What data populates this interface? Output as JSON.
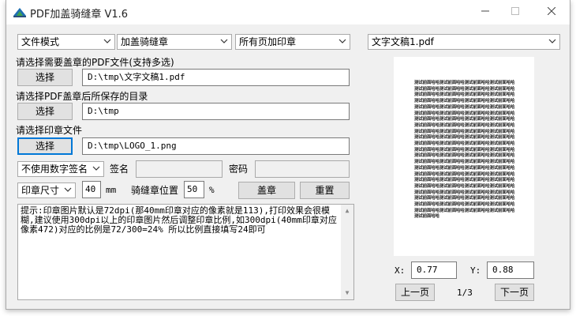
{
  "window": {
    "title": "PDF加盖骑缝章 V1.6",
    "icon": "pdf-stamp-app-icon"
  },
  "top": {
    "mode_select": "文件模式",
    "stamp_type_select": "加盖骑缝章",
    "pages_select": "所有页加印章",
    "file_select": "文字文稿1.pdf"
  },
  "pdf_section": {
    "label": "请选择需要盖章的PDF文件(支持多选)",
    "button": "选择",
    "path": "D:\\tmp\\文字文稿1.pdf"
  },
  "output_section": {
    "label": "请选择PDF盖章后所保存的目录",
    "button": "选择",
    "path": "D:\\tmp"
  },
  "stamp_section": {
    "label": "请选择印章文件",
    "button": "选择",
    "path": "D:\\tmp\\LOGO_1.png"
  },
  "signature": {
    "select": "不使用数字签名",
    "name_label": "签名",
    "name_value": "",
    "password_label": "密码",
    "password_value": ""
  },
  "size": {
    "select": "印章尺寸",
    "value": "40",
    "unit": "mm",
    "position_label": "骑缝章位置",
    "position_value": "50",
    "position_unit": "%",
    "stamp_button": "盖章",
    "reset_button": "重置"
  },
  "notes": "提示:印章图片默认是72dpi(那40mm印章对应的像素就是113),打印效果会很模糊,建议使用300dpi以上的印章图片然后调整印章比例,如300dpi(40mm印章对应像素472)对应的比例是72/300=24% 所以比例直接填写24即可",
  "preview": {
    "text": "测试前面哈哈测试前面哈哈测试前面哈哈测试前面哈哈测试前面哈哈测试前面哈哈测试前面哈哈测试前面哈哈测试前面哈哈测试前面哈哈测试前面哈哈测试前面哈哈测试前面哈哈测试前面哈哈测试前面哈哈测试前面哈哈测试前面哈哈测试前面哈哈测试前面哈哈测试前面哈哈测试前面哈哈测试前面哈哈测试前面哈哈测试前面哈哈测试前面哈哈测试前面哈哈测试前面哈哈测试前面哈哈测试前面哈哈测试前面哈哈测试前面哈哈测试前面哈哈测试前面哈哈测试前面哈哈测试前面哈哈测试前面哈哈测试前面哈哈测试前面哈哈测试前面哈哈测试前面哈哈测试前面哈哈测试前面哈哈测试前面哈哈测试前面哈哈测试前面哈哈测试前面哈哈测试前面哈哈测试前面哈哈测试前面哈哈测试前面哈哈测试前面哈哈测试前面哈哈测试前面哈哈测试前面哈哈测试前面哈哈测试前面哈哈测试前面哈哈测试前面哈哈测试前面哈哈测试前面哈哈测试前面哈哈测试前面哈哈测试前面哈哈测试前面哈哈测试前面哈哈测试前面哈哈测试前面哈哈测试前面哈哈测试前面哈哈测试前面哈哈测试前面哈哈测试前面哈哈测试前面哈哈测试前面哈哈测试前面哈哈测试前面哈哈测试前面哈哈测试前面哈哈测试前面哈哈测试前面哈哈测试前面哈哈测试前面哈哈测试前面哈哈测试前面哈哈测试前面哈哈测试前面哈哈测试前面哈哈测试前面哈哈测试前面哈哈"
  },
  "coords": {
    "x_label": "X:",
    "x_value": "0.77",
    "y_label": "Y:",
    "y_value": "0.88"
  },
  "pager": {
    "prev": "上一页",
    "indicator": "1/3",
    "next": "下一页"
  }
}
